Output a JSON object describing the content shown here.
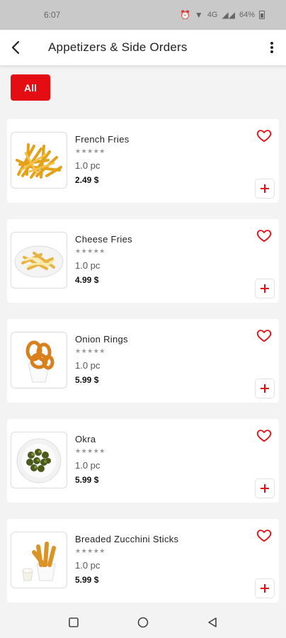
{
  "status_bar": {
    "time": "6:07",
    "battery_text": "64%",
    "network_text": "4G"
  },
  "header": {
    "title": "Appetizers & Side Orders",
    "back_icon": "chevron-left-icon",
    "menu_icon": "more-vertical-icon"
  },
  "filters": {
    "all_label": "All"
  },
  "colors": {
    "accent": "#e30d13",
    "background": "#f3f3f3",
    "card": "#ffffff"
  },
  "items": [
    {
      "name": "French Fries",
      "rating": "★★★★★",
      "quantity": "1.0 pc",
      "price": "2.49 $",
      "image": "french-fries"
    },
    {
      "name": "Cheese Fries",
      "rating": "★★★★★",
      "quantity": "1.0 pc",
      "price": "4.99 $",
      "image": "cheese-fries"
    },
    {
      "name": "Onion Rings",
      "rating": "★★★★★",
      "quantity": "1.0 pc",
      "price": "5.99 $",
      "image": "onion-rings"
    },
    {
      "name": "Okra",
      "rating": "★★★★★",
      "quantity": "1.0 pc",
      "price": "5.99 $",
      "image": "okra"
    },
    {
      "name": "Breaded Zucchini Sticks",
      "rating": "★★★★★",
      "quantity": "1.0 pc",
      "price": "5.99 $",
      "image": "zucchini-sticks"
    }
  ]
}
